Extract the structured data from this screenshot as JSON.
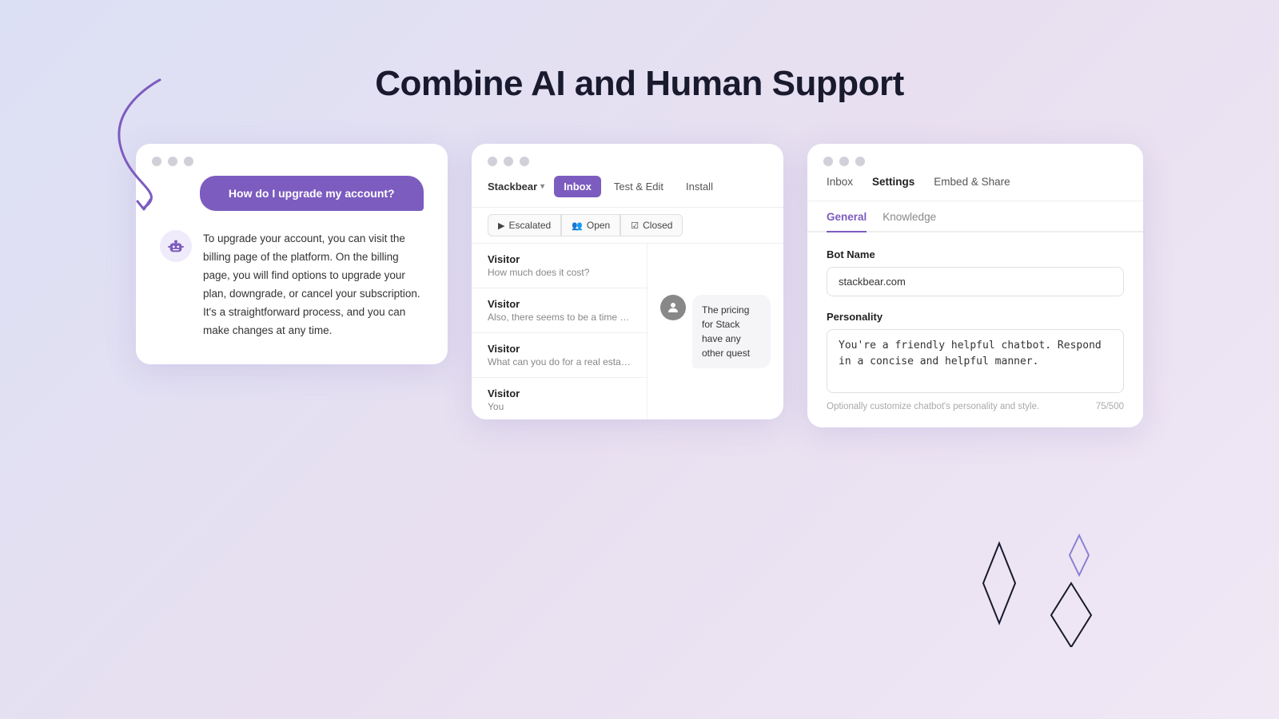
{
  "page": {
    "title": "Combine AI and Human Support",
    "background": "linear-gradient(135deg, #dce0f5 0%, #e8e0f0 50%, #f0e8f5 100%)"
  },
  "card_chat": {
    "dots": [
      "#d0d0d8",
      "#d0d0d8",
      "#d0d0d8"
    ],
    "user_bubble": "How do I upgrade my account?",
    "response_text": "To upgrade your account, you can visit the billing page of the platform. On the billing page, you will find options to upgrade your plan, downgrade, or cancel your subscription.\nIt's a straightforward process, and you can make changes at any time."
  },
  "card_inbox": {
    "brand": "Stackbear",
    "tabs": [
      {
        "label": "Inbox",
        "active": true
      },
      {
        "label": "Test & Edit",
        "active": false
      },
      {
        "label": "Install",
        "active": false
      }
    ],
    "filter_tabs": [
      {
        "label": "Escalated",
        "icon": "▶",
        "active": false
      },
      {
        "label": "Open",
        "icon": "👥",
        "active": false
      },
      {
        "label": "Closed",
        "icon": "☑",
        "active": false
      }
    ],
    "conversations": [
      {
        "name": "Visitor",
        "preview": "How much does it cost?"
      },
      {
        "name": "Visitor",
        "preview": "Also, there seems to be a time limit on typing messages,"
      },
      {
        "name": "Visitor",
        "preview": "What can you do for a real estate site?"
      },
      {
        "name": "Visitor",
        "preview": "You"
      }
    ],
    "agent_message": "The pricing for Stack have any other quest"
  },
  "card_settings": {
    "nav_items": [
      {
        "label": "Inbox",
        "active": false
      },
      {
        "label": "Settings",
        "active": true
      },
      {
        "label": "Embed & Share",
        "active": false
      }
    ],
    "sub_nav": [
      {
        "label": "General",
        "active": true
      },
      {
        "label": "Knowledge",
        "active": false
      }
    ],
    "bot_name_label": "Bot Name",
    "bot_name_value": "stackbear.com",
    "personality_label": "Personality",
    "personality_value": "You're a friendly helpful chatbot. Respond in a concise and helpful manner.",
    "personality_hint": "Optionally customize chatbot's personality and style.",
    "personality_count": "75/500"
  }
}
